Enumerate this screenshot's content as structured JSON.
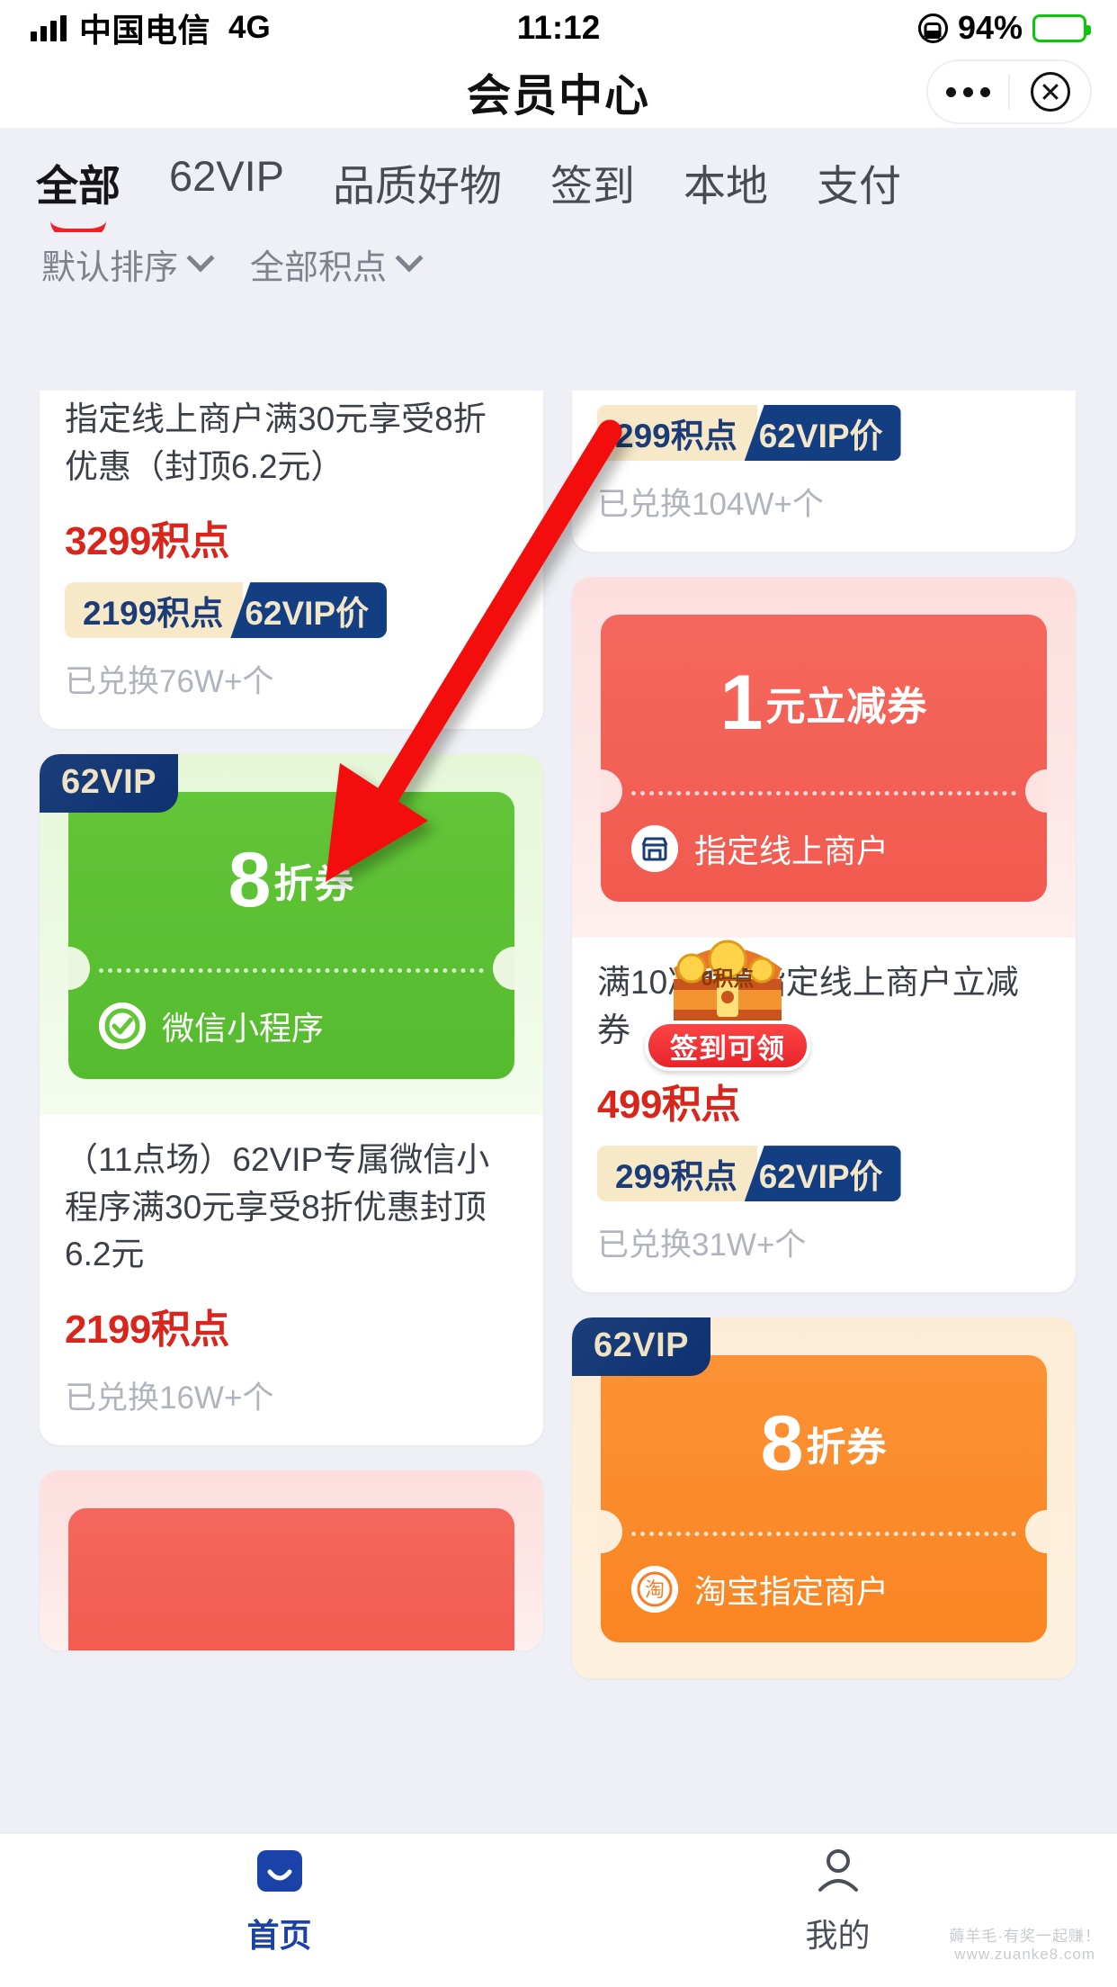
{
  "status_bar": {
    "carrier": "中国电信",
    "network": "4G",
    "time": "11:12",
    "battery_percent": "94%",
    "battery_charging": true,
    "lock_icon": "rotation-lock-icon"
  },
  "nav": {
    "title": "会员中心",
    "more_icon": "more-dots-icon",
    "close_icon": "close-circle-icon"
  },
  "tabs": [
    {
      "label": "全部",
      "active": true
    },
    {
      "label": "62VIP",
      "active": false
    },
    {
      "label": "品质好物",
      "active": false
    },
    {
      "label": "签到",
      "active": false
    },
    {
      "label": "本地",
      "active": false
    },
    {
      "label": "支付",
      "active": false
    }
  ],
  "filters": [
    {
      "label": "默认排序",
      "icon": "chevron-down-icon"
    },
    {
      "label": "全部积点",
      "icon": "chevron-down-icon"
    }
  ],
  "left_column": [
    {
      "id": "card-online-merchant-30-8off",
      "title": "指定线上商户满30元享受8折优惠（封顶6.2元）",
      "price": "3299积点",
      "vip_points": "2199积点",
      "vip_tag": "62VIP价",
      "redeemed": "已兑换76W+个",
      "coupon": null
    },
    {
      "id": "card-wechat-miniprogram-8off",
      "title": "（11点场）62VIP专属微信小程序满30元享受8折优惠封顶6.2元",
      "price": "2199积点",
      "vip_points": null,
      "vip_tag": null,
      "redeemed": "已兑换16W+个",
      "coupon": {
        "theme": "green",
        "vip_badge": "62VIP",
        "amount": "8",
        "unit": "折券",
        "merchant": "微信小程序",
        "merchant_icon": "wechat-check-icon"
      }
    },
    {
      "id": "card-partial-red-bottom",
      "title": "",
      "price": null,
      "vip_points": null,
      "vip_tag": null,
      "redeemed": null,
      "coupon": {
        "theme": "red",
        "vip_badge": null,
        "amount": "",
        "unit": "",
        "merchant": "",
        "merchant_icon": "store-icon"
      }
    }
  ],
  "right_column": [
    {
      "id": "card-top-partial",
      "title": "",
      "price": null,
      "vip_points": "299积点",
      "vip_tag": "62VIP价",
      "redeemed": "已兑换104W+个",
      "coupon": null
    },
    {
      "id": "card-man10-jian1",
      "title": "满10减1元指定线上商户立减券",
      "price": "499积点",
      "vip_points": "299积点",
      "vip_tag": "62VIP价",
      "redeemed": "已兑换31W+个",
      "coupon": {
        "theme": "red",
        "vip_badge": null,
        "amount": "1",
        "unit": "元立减券",
        "merchant": "指定线上商户",
        "merchant_icon": "store-icon"
      }
    },
    {
      "id": "card-taobao-8off",
      "title": "",
      "price": null,
      "vip_points": null,
      "vip_tag": null,
      "redeemed": null,
      "coupon": {
        "theme": "orange",
        "vip_badge": "62VIP",
        "amount": "8",
        "unit": "折券",
        "merchant": "淘宝指定商户",
        "merchant_icon": "taobao-icon"
      }
    }
  ],
  "floating_chest": {
    "points_label": "6积点",
    "cta_label": "签到可领",
    "icon": "treasure-chest-icon"
  },
  "annotation": {
    "type": "red-arrow",
    "color": "#f40b0b",
    "points_to": "62VIP 微信小程序 8折券 card"
  },
  "bottom_nav": [
    {
      "label": "首页",
      "icon": "home-icon",
      "active": true
    },
    {
      "label": "我的",
      "icon": "person-icon",
      "active": false
    }
  ],
  "watermark": {
    "line1": "薅羊毛·有奖一起赚！",
    "line2": "www.zuanke8.com"
  },
  "colors": {
    "accent_red": "#f0202b",
    "price_red": "#d9261c",
    "vip_navy": "#133f82",
    "vip_cream": "#f7e9c8",
    "green_coupon": "#63c538",
    "red_coupon": "#f4675c",
    "orange_coupon": "#fb9235",
    "page_bg": "#eef0f5",
    "nav_active": "#1b42a8"
  }
}
